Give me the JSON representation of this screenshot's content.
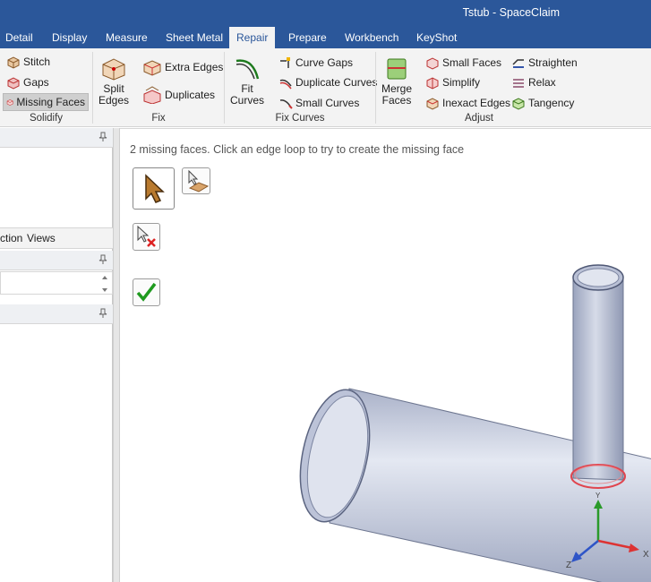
{
  "window": {
    "title": "Tstub - SpaceClaim"
  },
  "tabs": [
    {
      "label": "Detail"
    },
    {
      "label": "Display"
    },
    {
      "label": "Measure"
    },
    {
      "label": "Sheet Metal"
    },
    {
      "label": "Repair"
    },
    {
      "label": "Prepare"
    },
    {
      "label": "Workbench"
    },
    {
      "label": "KeyShot"
    }
  ],
  "active_tab": "Repair",
  "ribbon": {
    "solidify": {
      "label": "Solidify",
      "stitch": "Stitch",
      "gaps": "Gaps",
      "missing_faces": "Missing Faces"
    },
    "fix": {
      "label": "Fix",
      "split_edges_1": "Split",
      "split_edges_2": "Edges",
      "extra_edges": "Extra Edges",
      "duplicates": "Duplicates"
    },
    "fix_curves": {
      "label": "Fix Curves",
      "fit_curves_1": "Fit",
      "fit_curves_2": "Curves",
      "curve_gaps": "Curve Gaps",
      "duplicate_curves": "Duplicate Curves",
      "small_curves": "Small Curves"
    },
    "adjust": {
      "label": "Adjust",
      "merge_faces_1": "Merge",
      "merge_faces_2": "Faces",
      "small_faces": "Small Faces",
      "simplify": "Simplify",
      "inexact_edges": "Inexact Edges",
      "straighten": "Straighten",
      "relax": "Relax",
      "tangency": "Tangency"
    }
  },
  "left_panel": {
    "tab_section": "ction",
    "tab_views": "Views"
  },
  "viewport": {
    "status_text": "2 missing faces. Click an edge loop to try to create the missing face",
    "axis_labels": {
      "x": "X",
      "y": "Y",
      "z": "Z"
    }
  },
  "colors": {
    "accent": "#2b579a",
    "ribbon_bg": "#f3f3f3",
    "pipe_fill": "#c9cfe0",
    "edge_highlight": "#e0454f"
  }
}
